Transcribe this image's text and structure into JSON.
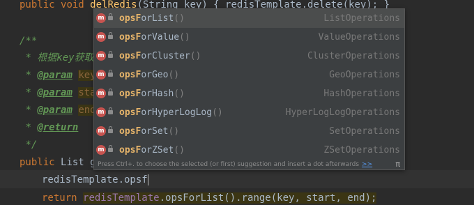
{
  "editor": {
    "line1": {
      "kw": "public",
      "type": "void",
      "name": "delRedis",
      "rest": "(String key) { redisTemplate.delete(key); }"
    },
    "doc_open": "/**",
    "doc_desc": "* 根据key获取",
    "doc_param_key": {
      "star": "*",
      "tag": "@param",
      "name": "key"
    },
    "doc_param_start": {
      "star": "*",
      "tag": "@param",
      "name": "start"
    },
    "doc_param_end": {
      "star": "*",
      "tag": "@param",
      "name": "end"
    },
    "doc_return": {
      "star": "*",
      "tag": "@return"
    },
    "doc_close": "*/",
    "line_sig": {
      "kw": "public",
      "rest": "List get"
    },
    "caret_line": "redisTemplate.opsf",
    "return_line": {
      "kw": "return",
      "obj": "redisTemplate",
      "call": ".opsForList().range(key, start, end);"
    }
  },
  "popup": {
    "prefix": "ops",
    "items": [
      {
        "icon": "m",
        "match": "opsF",
        "rest": "orList",
        "paren": "()",
        "type": "ListOperations"
      },
      {
        "icon": "m",
        "match": "opsF",
        "rest": "orValue",
        "paren": "()",
        "type": "ValueOperations"
      },
      {
        "icon": "m",
        "match": "opsF",
        "rest": "orCluster",
        "paren": "()",
        "type": "ClusterOperations"
      },
      {
        "icon": "m",
        "match": "opsF",
        "rest": "orGeo",
        "paren": "()",
        "type": "GeoOperations"
      },
      {
        "icon": "m",
        "match": "opsF",
        "rest": "orHash",
        "paren": "()",
        "type": "HashOperations"
      },
      {
        "icon": "m",
        "match": "opsF",
        "rest": "orHyperLogLog",
        "paren": "()",
        "type": "HyperLogLogOperations"
      },
      {
        "icon": "m",
        "match": "opsF",
        "rest": "orSet",
        "paren": "()",
        "type": "SetOperations"
      },
      {
        "icon": "m",
        "match": "opsF",
        "rest": "orZSet",
        "paren": "()",
        "type": "ZSetOperations"
      }
    ],
    "hint_text": "Press Ctrl+. to choose the selected (or first) suggestion and insert a dot afterwards",
    "hint_link": ">>",
    "hint_pi": "π"
  },
  "colors": {
    "background": "#2b2b2b",
    "keyword": "#cc7832",
    "doc": "#629755",
    "match": "#e6b46a"
  }
}
